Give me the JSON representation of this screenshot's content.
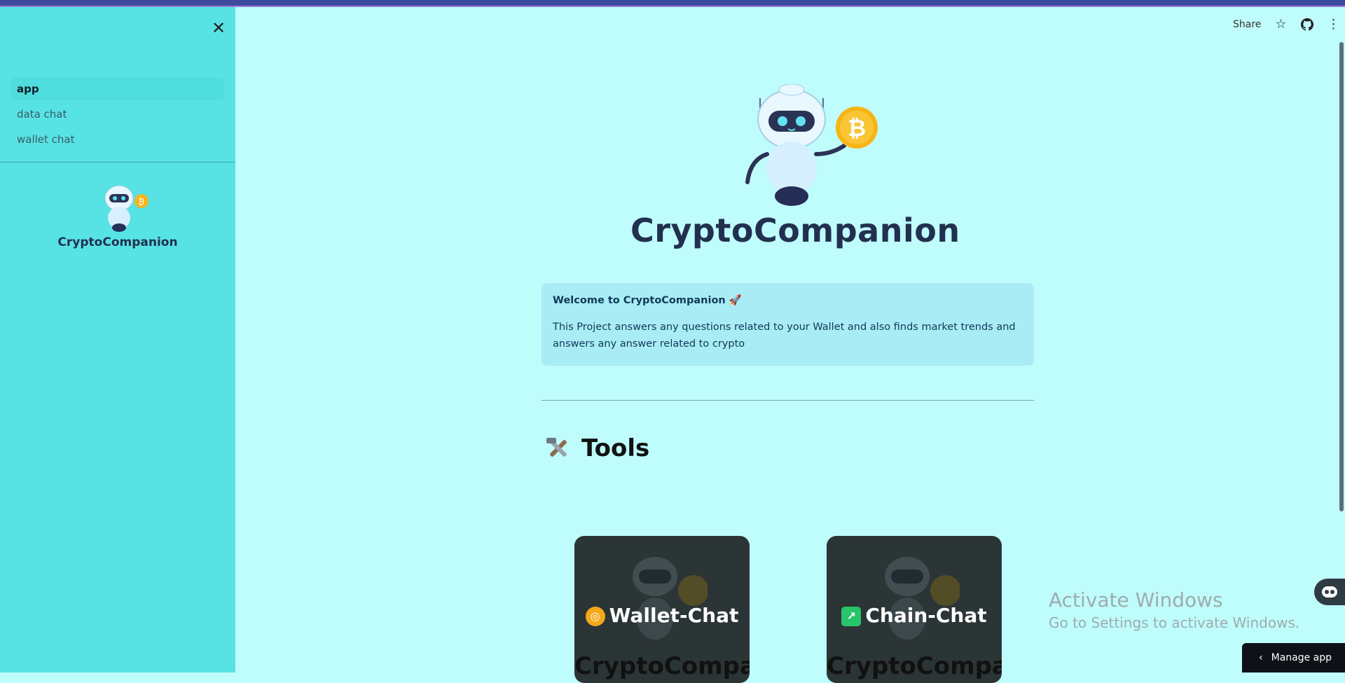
{
  "sidebar": {
    "items": [
      {
        "label": "app",
        "active": true
      },
      {
        "label": "data chat",
        "active": false
      },
      {
        "label": "wallet chat",
        "active": false
      }
    ],
    "logo_text": "CryptoCompanion",
    "close_icon": "close-icon"
  },
  "header": {
    "share_label": "Share",
    "icons": [
      "star-icon",
      "github-icon",
      "more-vertical-icon"
    ]
  },
  "main": {
    "title": "CryptoCompanion",
    "info": {
      "title": "Welcome to CryptoCompanion 🚀",
      "body": "This Project answers any questions related to your Wallet and also finds market trends and answers any answer related to crypto"
    },
    "tools_heading": "Tools",
    "cards": [
      {
        "label": "Wallet-Chat",
        "icon": "coin-icon",
        "ghost_text": "CryptoCompanion"
      },
      {
        "label": "Chain-Chat",
        "icon": "chart-icon",
        "ghost_text": "CryptoCompanion"
      }
    ]
  },
  "watermark": {
    "line1": "Activate Windows",
    "line2": "Go to Settings to activate Windows."
  },
  "manage_app_label": "Manage app",
  "colors": {
    "background": "#bffcfc",
    "sidebar": "#57e3e3",
    "info_box": "#a9ecf5",
    "card": "#2c3535",
    "title": "#22304f"
  }
}
